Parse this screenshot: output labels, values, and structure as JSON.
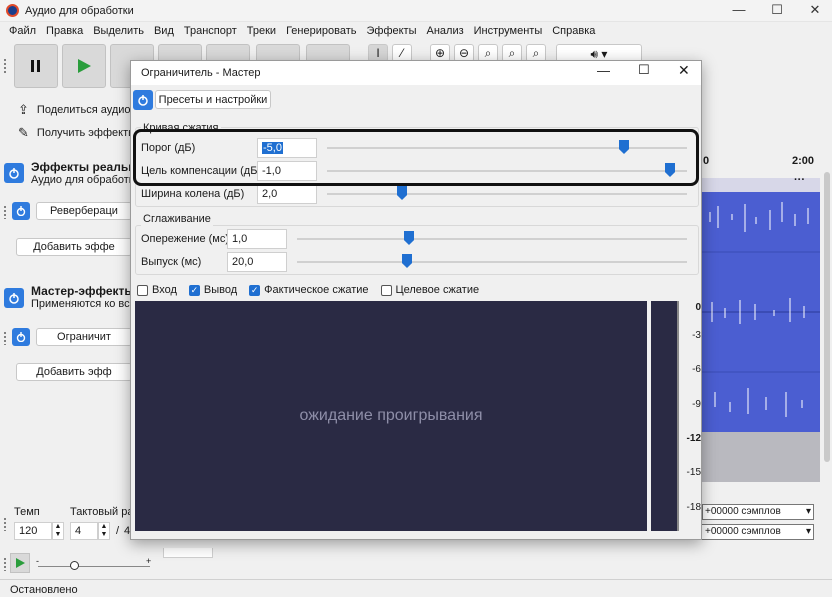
{
  "window": {
    "title": "Аудио для обработки",
    "minimize": "—",
    "maximize": "☐",
    "close": "✕"
  },
  "menu": [
    "Файл",
    "Правка",
    "Выделить",
    "Вид",
    "Транспорт",
    "Треки",
    "Генерировать",
    "Эффекты",
    "Анализ",
    "Инструменты",
    "Справка"
  ],
  "left_panel": {
    "share_label": "Поделиться аудио",
    "get_effects_label": "Получить эффекты",
    "realtime_title": "Эффекты реальног",
    "realtime_sub": "Аудио для обработки",
    "reverb_label": "Ревербераци",
    "add_effect1": "Добавить эффе",
    "master_title": "Мастер-эффекты",
    "master_sub": "Применяются ко все",
    "limiter_label": "Ограничит",
    "add_effect2": "Добавить эфф",
    "tempo_label": "Темп",
    "tempo_value": "120",
    "meter_label": "Тактовый ра",
    "meter_value": "4",
    "meter_den": "4",
    "status": "Остановлено"
  },
  "timeline": {
    "mark": "2:00",
    "mark0": "0"
  },
  "sample_readouts": [
    "+00000 сэмплов",
    "+00000 сэмплов"
  ],
  "dialog": {
    "title": "Ограничитель - Мастер",
    "presets": "Пресеты и настройки",
    "curve_group": "Кривая сжатия",
    "threshold_label": "Порог (дБ)",
    "threshold_value": "-5,0",
    "makeup_label": "Цель компенсации (дБ)",
    "makeup_value": "-1,0",
    "knee_label": "Ширина колена (дБ)",
    "knee_value": "2,0",
    "smoothing_group": "Сглаживание",
    "lookahead_label": "Опережение (мс)",
    "lookahead_value": "1,0",
    "release_label": "Выпуск (мс)",
    "release_value": "20,0",
    "chk_input": "Вход",
    "chk_output": "Вывод",
    "chk_actual": "Фактическое сжатие",
    "chk_target": "Целевое сжатие",
    "waiting": "ожидание проигрывания",
    "db_ticks": [
      "0",
      "-3",
      "-6",
      "-9",
      "-12",
      "-15",
      "-18"
    ],
    "checks": {
      "input": false,
      "output": true,
      "actual": true,
      "target": false
    }
  },
  "colors": {
    "accent": "#1f6fd1",
    "graph_bg": "#2a2a44",
    "wave": "#4b5ed1",
    "highlight": "#111111"
  }
}
